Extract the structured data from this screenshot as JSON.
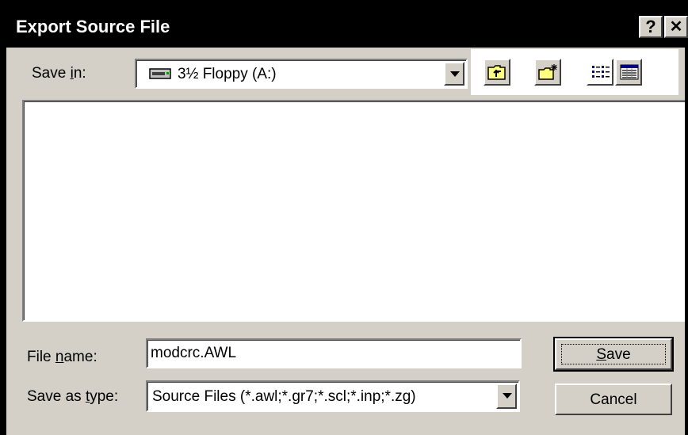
{
  "window": {
    "title": "Export Source File",
    "help_label": "?",
    "close_label": "✕"
  },
  "save_in": {
    "label_pre": "Save ",
    "label_accel": "i",
    "label_post": "n:",
    "value": "3½ Floppy (A:)",
    "icon": "floppy-drive-icon"
  },
  "toolbar": {
    "buttons": [
      {
        "name": "up-one-level",
        "icon": "folder-up-icon"
      },
      {
        "name": "create-new-folder",
        "icon": "new-folder-icon"
      },
      {
        "name": "list-view",
        "icon": "list-view-icon"
      },
      {
        "name": "details-view",
        "icon": "details-view-icon"
      }
    ]
  },
  "file_list": {
    "items": []
  },
  "file_name": {
    "label_pre": "File ",
    "label_accel": "n",
    "label_post": "ame:",
    "value": "modcrc.AWL"
  },
  "save_as_type": {
    "label_pre": "Save as ",
    "label_accel": "t",
    "label_post": "ype:",
    "value": "Source Files (*.awl;*.gr7;*.scl;*.inp;*.zg)"
  },
  "buttons": {
    "save_accel": "S",
    "save_rest": "ave",
    "cancel": "Cancel"
  },
  "colors": {
    "dialog_bg": "#d4d0c8",
    "titlebar_bg": "#000000",
    "titlebar_text": "#ffffff",
    "icon_yellow": "#ffff80"
  }
}
